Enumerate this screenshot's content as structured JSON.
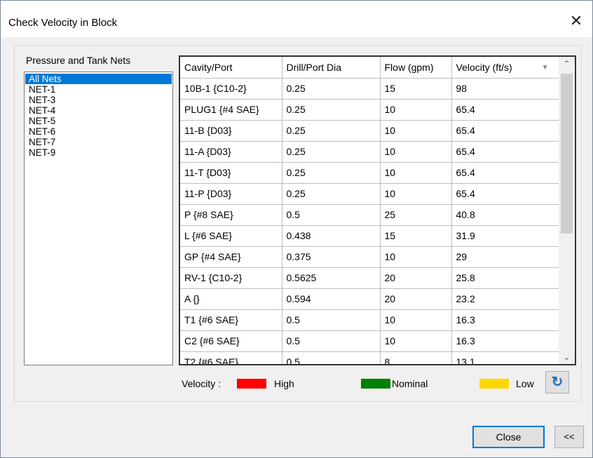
{
  "window": {
    "title": "Check Velocity in Block",
    "close_glyph": "✕"
  },
  "nets": {
    "label": "Pressure and Tank Nets",
    "items": [
      "All Nets",
      "NET-1",
      "NET-3",
      "NET-4",
      "NET-5",
      "NET-6",
      "NET-7",
      "NET-9"
    ],
    "selected": "All Nets"
  },
  "table": {
    "columns": [
      "Cavity/Port",
      "Drill/Port Dia",
      "Flow (gpm)",
      "Velocity (ft/s)"
    ],
    "rows": [
      [
        "10B-1  {C10-2}",
        "0.25",
        "15",
        "98"
      ],
      [
        "PLUG1  {#4 SAE}",
        "0.25",
        "10",
        "65.4"
      ],
      [
        "11-B  {D03}",
        "0.25",
        "10",
        "65.4"
      ],
      [
        "11-A  {D03}",
        "0.25",
        "10",
        "65.4"
      ],
      [
        "11-T  {D03}",
        "0.25",
        "10",
        "65.4"
      ],
      [
        "11-P  {D03}",
        "0.25",
        "10",
        "65.4"
      ],
      [
        "P  {#8 SAE}",
        "0.5",
        "25",
        "40.8"
      ],
      [
        "L  {#6 SAE}",
        "0.438",
        "15",
        "31.9"
      ],
      [
        "GP  {#4 SAE}",
        "0.375",
        "10",
        "29"
      ],
      [
        "RV-1  {C10-2}",
        "0.5625",
        "20",
        "25.8"
      ],
      [
        "A  {}",
        "0.594",
        "20",
        "23.2"
      ],
      [
        "T1  {#6 SAE}",
        "0.5",
        "10",
        "16.3"
      ],
      [
        "C2  {#6 SAE}",
        "0.5",
        "10",
        "16.3"
      ],
      [
        "T2  {#6 SAE}",
        "0.5",
        "8",
        "13.1"
      ]
    ]
  },
  "legend": {
    "label": "Velocity :",
    "high": "High",
    "nominal": "Nominal",
    "low": "Low",
    "colors": {
      "high": "#ff0000",
      "nominal": "#008000",
      "low": "#ffd700"
    }
  },
  "buttons": {
    "close": "Close",
    "collapse": "<<",
    "refresh_icon": "refresh-icon"
  }
}
